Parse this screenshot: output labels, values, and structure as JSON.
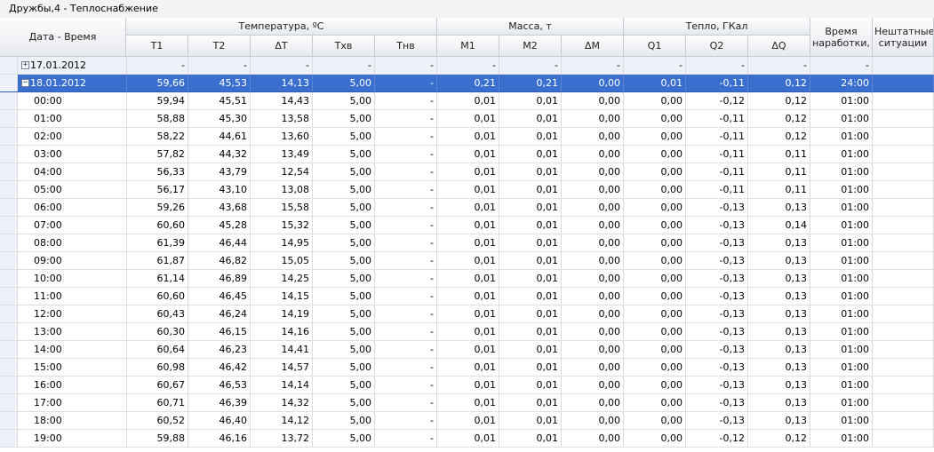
{
  "window": {
    "title": "Дружбы,4 - Теплоснабжение"
  },
  "header": {
    "datetime": "Дата - Время",
    "groups": {
      "temperature": "Температура, ºС",
      "mass": "Масса, т",
      "heat": "Тепло, ГКал"
    },
    "runtime": "Время наработки,",
    "emergency": "Нештатные ситуации",
    "columns": [
      "T1",
      "T2",
      "ΔT",
      "Txв",
      "Tнв",
      "M1",
      "M2",
      "ΔM",
      "Q1",
      "Q2",
      "ΔQ"
    ]
  },
  "groups": [
    {
      "label": "17.01.2012",
      "expander": "+",
      "state": "collapsed",
      "cells": [
        "-",
        "-",
        "-",
        "-",
        "-",
        "-",
        "-",
        "-",
        "-",
        "-",
        "-",
        "-",
        ""
      ]
    },
    {
      "label": "18.01.2012",
      "expander": "−",
      "state": "selected",
      "cells": [
        "59,66",
        "45,53",
        "14,13",
        "5,00",
        "-",
        "0,21",
        "0,21",
        "0,00",
        "0,01",
        "-0,11",
        "0,12",
        "24:00",
        ""
      ]
    }
  ],
  "rows": [
    {
      "time": "00:00",
      "cells": [
        "59,94",
        "45,51",
        "14,43",
        "5,00",
        "-",
        "0,01",
        "0,01",
        "0,00",
        "0,00",
        "-0,12",
        "0,12",
        "01:00",
        ""
      ]
    },
    {
      "time": "01:00",
      "cells": [
        "58,88",
        "45,30",
        "13,58",
        "5,00",
        "-",
        "0,01",
        "0,01",
        "0,00",
        "0,00",
        "-0,11",
        "0,12",
        "01:00",
        ""
      ]
    },
    {
      "time": "02:00",
      "cells": [
        "58,22",
        "44,61",
        "13,60",
        "5,00",
        "-",
        "0,01",
        "0,01",
        "0,00",
        "0,00",
        "-0,11",
        "0,12",
        "01:00",
        ""
      ]
    },
    {
      "time": "03:00",
      "cells": [
        "57,82",
        "44,32",
        "13,49",
        "5,00",
        "-",
        "0,01",
        "0,01",
        "0,00",
        "0,00",
        "-0,11",
        "0,11",
        "01:00",
        ""
      ]
    },
    {
      "time": "04:00",
      "cells": [
        "56,33",
        "43,79",
        "12,54",
        "5,00",
        "-",
        "0,01",
        "0,01",
        "0,00",
        "0,00",
        "-0,11",
        "0,11",
        "01:00",
        ""
      ]
    },
    {
      "time": "05:00",
      "cells": [
        "56,17",
        "43,10",
        "13,08",
        "5,00",
        "-",
        "0,01",
        "0,01",
        "0,00",
        "0,00",
        "-0,11",
        "0,11",
        "01:00",
        ""
      ]
    },
    {
      "time": "06:00",
      "cells": [
        "59,26",
        "43,68",
        "15,58",
        "5,00",
        "-",
        "0,01",
        "0,01",
        "0,00",
        "0,00",
        "-0,13",
        "0,13",
        "01:00",
        ""
      ]
    },
    {
      "time": "07:00",
      "cells": [
        "60,60",
        "45,28",
        "15,32",
        "5,00",
        "-",
        "0,01",
        "0,01",
        "0,00",
        "0,00",
        "-0,13",
        "0,14",
        "01:00",
        ""
      ]
    },
    {
      "time": "08:00",
      "cells": [
        "61,39",
        "46,44",
        "14,95",
        "5,00",
        "-",
        "0,01",
        "0,01",
        "0,00",
        "0,00",
        "-0,13",
        "0,13",
        "01:00",
        ""
      ]
    },
    {
      "time": "09:00",
      "cells": [
        "61,87",
        "46,82",
        "15,05",
        "5,00",
        "-",
        "0,01",
        "0,01",
        "0,00",
        "0,00",
        "-0,13",
        "0,13",
        "01:00",
        ""
      ]
    },
    {
      "time": "10:00",
      "cells": [
        "61,14",
        "46,89",
        "14,25",
        "5,00",
        "-",
        "0,01",
        "0,01",
        "0,00",
        "0,00",
        "-0,13",
        "0,13",
        "01:00",
        ""
      ]
    },
    {
      "time": "11:00",
      "cells": [
        "60,60",
        "46,45",
        "14,15",
        "5,00",
        "-",
        "0,01",
        "0,01",
        "0,00",
        "0,00",
        "-0,13",
        "0,13",
        "01:00",
        ""
      ]
    },
    {
      "time": "12:00",
      "cells": [
        "60,43",
        "46,24",
        "14,19",
        "5,00",
        "-",
        "0,01",
        "0,01",
        "0,00",
        "0,00",
        "-0,13",
        "0,13",
        "01:00",
        ""
      ]
    },
    {
      "time": "13:00",
      "cells": [
        "60,30",
        "46,15",
        "14,16",
        "5,00",
        "-",
        "0,01",
        "0,01",
        "0,00",
        "0,00",
        "-0,13",
        "0,13",
        "01:00",
        ""
      ]
    },
    {
      "time": "14:00",
      "cells": [
        "60,64",
        "46,23",
        "14,41",
        "5,00",
        "-",
        "0,01",
        "0,01",
        "0,00",
        "0,00",
        "-0,13",
        "0,13",
        "01:00",
        ""
      ]
    },
    {
      "time": "15:00",
      "cells": [
        "60,98",
        "46,42",
        "14,57",
        "5,00",
        "-",
        "0,01",
        "0,01",
        "0,00",
        "0,00",
        "-0,13",
        "0,13",
        "01:00",
        ""
      ]
    },
    {
      "time": "16:00",
      "cells": [
        "60,67",
        "46,53",
        "14,14",
        "5,00",
        "-",
        "0,01",
        "0,01",
        "0,00",
        "0,00",
        "-0,13",
        "0,13",
        "01:00",
        ""
      ]
    },
    {
      "time": "17:00",
      "cells": [
        "60,71",
        "46,39",
        "14,32",
        "5,00",
        "-",
        "0,01",
        "0,01",
        "0,00",
        "0,00",
        "-0,13",
        "0,13",
        "01:00",
        ""
      ]
    },
    {
      "time": "18:00",
      "cells": [
        "60,52",
        "46,40",
        "14,12",
        "5,00",
        "-",
        "0,01",
        "0,01",
        "0,00",
        "0,00",
        "-0,13",
        "0,13",
        "01:00",
        ""
      ]
    },
    {
      "time": "19:00",
      "cells": [
        "59,88",
        "46,16",
        "13,72",
        "5,00",
        "-",
        "0,01",
        "0,01",
        "0,00",
        "0,00",
        "-0,12",
        "0,12",
        "01:00",
        ""
      ]
    }
  ]
}
